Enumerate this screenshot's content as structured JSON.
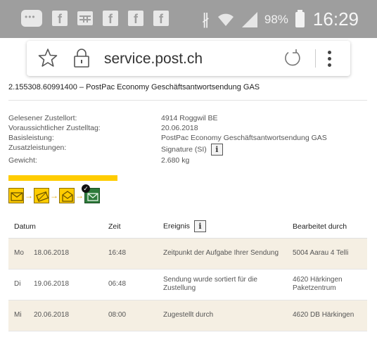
{
  "statusbar": {
    "battery_percent": "98%",
    "time": "16:29",
    "icons": [
      "chat-icon",
      "facebook-icon",
      "gallery-icon",
      "facebook-icon",
      "facebook-icon",
      "facebook-icon",
      "bluetooth-icon",
      "wifi-icon",
      "signal-icon",
      "battery-icon"
    ]
  },
  "browser": {
    "url": "service.post.ch"
  },
  "shipment": {
    "title": "2.155308.60991400 – PostPac Economy Geschäftsantwortsendung GAS",
    "details": [
      {
        "label": "Gelesener Zustellort:",
        "value": "4914 Roggwil BE"
      },
      {
        "label": "Voraussichtlicher Zustelltag:",
        "value": "20.06.2018"
      },
      {
        "label": "Basisleistung:",
        "value": "PostPac Economy Geschäftsantwortsendung GAS"
      },
      {
        "label": "Zusatzleistungen:",
        "value": "Signature (SI)"
      },
      {
        "label": "Gewicht:",
        "value": "2.680 kg"
      }
    ],
    "info_glyph": "i",
    "progress_fraction": 1.0
  },
  "table": {
    "headers": {
      "date": "Datum",
      "time": "Zeit",
      "event": "Ereignis",
      "by": "Bearbeitet durch"
    },
    "rows": [
      {
        "day": "Mo",
        "date": "18.06.2018",
        "time": "16:48",
        "event": "Zeitpunkt der Aufgabe Ihrer Sendung",
        "by": "5004 Aarau 4 Telli"
      },
      {
        "day": "Di",
        "date": "19.06.2018",
        "time": "06:48",
        "event": "Sendung wurde sortiert für die Zustellung",
        "by": "4620 Härkingen Paketzentrum"
      },
      {
        "day": "Mi",
        "date": "20.06.2018",
        "time": "08:00",
        "event": "Zugestellt durch",
        "by": "4620 DB Härkingen"
      }
    ]
  },
  "colors": {
    "status_bar": "#9e9e9e",
    "progress": "#ffcc00",
    "row_shade": "#f5efe3",
    "delivered": "#2d7a3a"
  }
}
